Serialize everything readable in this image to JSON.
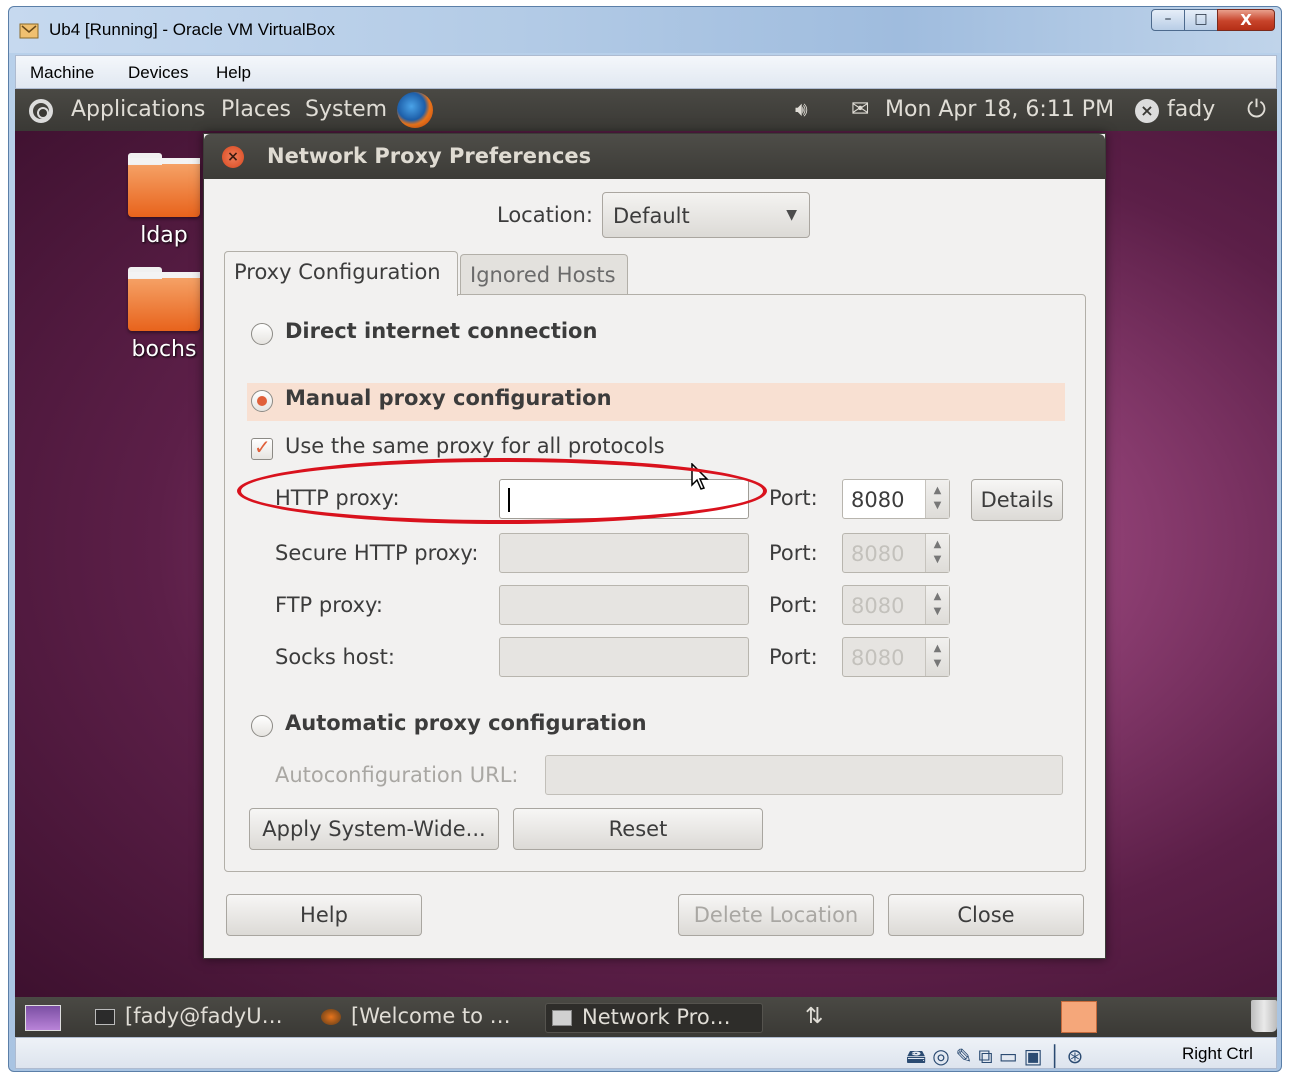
{
  "host_window": {
    "title": "Ub4 [Running] - Oracle VM VirtualBox",
    "controls": {
      "minimize": "–",
      "maximize": "□",
      "close": "X"
    },
    "menu": [
      "Machine",
      "Devices",
      "Help"
    ],
    "status_bar": {
      "host_key": "Right Ctrl"
    }
  },
  "guest": {
    "top_panel": {
      "menus": [
        "Applications",
        "Places",
        "System"
      ],
      "clock": "Mon Apr 18,  6:11 PM",
      "user": "fady"
    },
    "desktop_icons": [
      "ldap",
      "bochs"
    ],
    "taskbar": {
      "tasks": [
        "[fady@fadyU…",
        "[Welcome to …",
        "Network Pro…"
      ]
    }
  },
  "dialog": {
    "title": "Network Proxy Preferences",
    "location_label": "Location:",
    "location_value": "Default",
    "tabs": [
      "Proxy Configuration",
      "Ignored Hosts"
    ],
    "options": {
      "direct": "Direct internet connection",
      "manual": "Manual proxy configuration",
      "automatic": "Automatic proxy configuration",
      "selected": "manual"
    },
    "same_proxy_label": "Use the same proxy for all protocols",
    "same_proxy_checked": true,
    "proxies": [
      {
        "label": "HTTP proxy:",
        "host": "",
        "port_label": "Port:",
        "port": "8080",
        "enabled": true
      },
      {
        "label": "Secure HTTP proxy:",
        "host": "",
        "port_label": "Port:",
        "port": "8080",
        "enabled": false
      },
      {
        "label": "FTP proxy:",
        "host": "",
        "port_label": "Port:",
        "port": "8080",
        "enabled": false
      },
      {
        "label": "Socks host:",
        "host": "",
        "port_label": "Port:",
        "port": "8080",
        "enabled": false
      }
    ],
    "details_button": "Details",
    "autoconfig_label": "Autoconfiguration URL:",
    "autoconfig_value": "",
    "apply_button": "Apply System-Wide...",
    "reset_button": "Reset",
    "help_button": "Help",
    "delete_location_button": "Delete Location",
    "close_button": "Close"
  },
  "colors": {
    "accent_orange": "#e0603a",
    "annotation_red": "#d9121d",
    "panel_dark": "#3c3b37"
  }
}
